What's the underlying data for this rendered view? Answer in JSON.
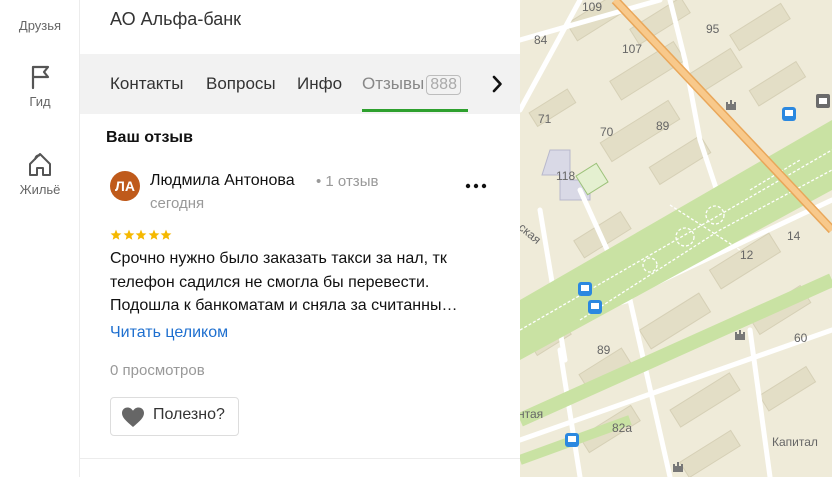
{
  "rail": {
    "friends_label": "Друзья",
    "guide_label": "Гид",
    "housing_label": "Жильё"
  },
  "panel": {
    "org_name": "АО Альфа-банк"
  },
  "tabs": {
    "contacts": "Контакты",
    "questions": "Вопросы",
    "info": "Инфо",
    "reviews": "Отзывы",
    "reviews_count": "888",
    "active": "reviews"
  },
  "review_section": {
    "heading": "Ваш отзыв"
  },
  "review": {
    "avatar_initials": "ЛА",
    "avatar_color": "#bf5a1b",
    "author": "Людмила Антонова",
    "author_reviews": "• 1 отзыв",
    "date": "сегодня",
    "rating": 5,
    "star_color": "#f5b800",
    "text_lines": [
      "Срочно нужно было заказать такси за нал, тк",
      "телефон садился не смогла бы перевести.",
      "Подошла к банкоматам и сняла за считанны…"
    ],
    "read_more": "Читать целиком",
    "views": "0 просмотров",
    "helpful_label": "Полезно?"
  },
  "map": {
    "labels": {
      "n109": "109",
      "n95": "95",
      "n84": "84",
      "n107": "107",
      "n71": "71",
      "n70": "70",
      "n89a": "89",
      "n118": "118",
      "n12": "12",
      "n14": "14",
      "n60": "60",
      "n89b": "89",
      "n82a": "82а",
      "street1": "ская",
      "street2": "нтая",
      "capital": "Капитал"
    },
    "colors": {
      "land": "#efebd9",
      "building": "#e3dec6",
      "park": "#c9e2a3",
      "road": "#ffffff",
      "highway": "#f4b56b",
      "transit": "#2b88e0"
    }
  }
}
